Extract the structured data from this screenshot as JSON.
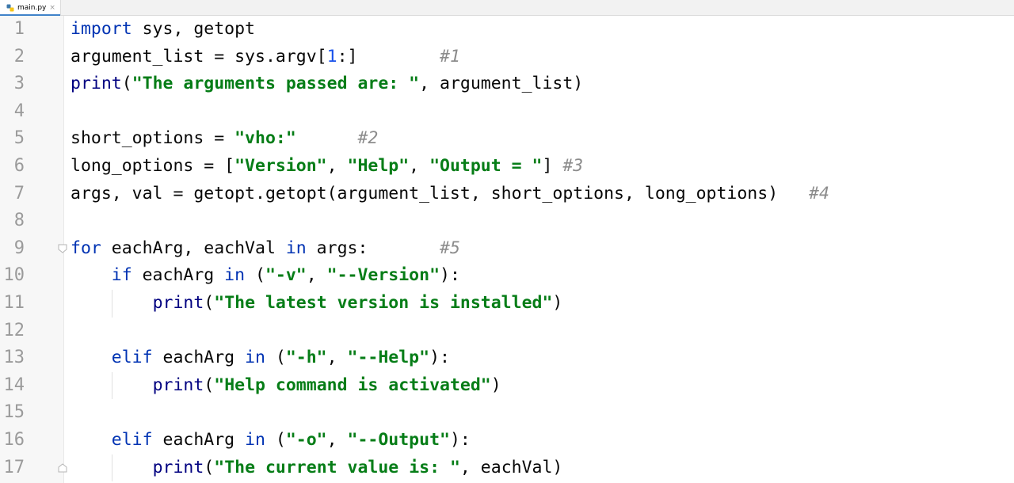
{
  "tab": {
    "filename": "main.py",
    "close": "×"
  },
  "line_numbers": [
    "1",
    "2",
    "3",
    "4",
    "5",
    "6",
    "7",
    "8",
    "9",
    "10",
    "11",
    "12",
    "13",
    "14",
    "15",
    "16",
    "17"
  ],
  "code_lines": [
    [
      {
        "t": "kw",
        "s": "import"
      },
      {
        "t": "",
        "s": " sys, getopt"
      }
    ],
    [
      {
        "t": "",
        "s": "argument_list = sys.argv["
      },
      {
        "t": "num",
        "s": "1"
      },
      {
        "t": "",
        "s": ":]"
      },
      {
        "t": "",
        "s": "        "
      },
      {
        "t": "cmt",
        "s": "#1"
      }
    ],
    [
      {
        "t": "bi",
        "s": "print"
      },
      {
        "t": "",
        "s": "("
      },
      {
        "t": "str",
        "s": "\"The arguments passed are: \""
      },
      {
        "t": "",
        "s": ", argument_list)"
      }
    ],
    [],
    [
      {
        "t": "",
        "s": "short_options = "
      },
      {
        "t": "str",
        "s": "\"vho:\""
      },
      {
        "t": "",
        "s": "      "
      },
      {
        "t": "cmt",
        "s": "#2"
      }
    ],
    [
      {
        "t": "",
        "s": "long_options = ["
      },
      {
        "t": "str",
        "s": "\"Version\""
      },
      {
        "t": "",
        "s": ", "
      },
      {
        "t": "str",
        "s": "\"Help\""
      },
      {
        "t": "",
        "s": ", "
      },
      {
        "t": "str",
        "s": "\"Output = \""
      },
      {
        "t": "",
        "s": "] "
      },
      {
        "t": "cmt",
        "s": "#3"
      }
    ],
    [
      {
        "t": "",
        "s": "args, val = getopt.getopt(argument_list, short_options, long_options)"
      },
      {
        "t": "",
        "s": "   "
      },
      {
        "t": "cmt",
        "s": "#4"
      }
    ],
    [],
    [
      {
        "t": "kw",
        "s": "for"
      },
      {
        "t": "",
        "s": " eachArg, eachVal "
      },
      {
        "t": "kw",
        "s": "in"
      },
      {
        "t": "",
        "s": " args:"
      },
      {
        "t": "",
        "s": "       "
      },
      {
        "t": "cmt",
        "s": "#5"
      }
    ],
    [
      {
        "t": "",
        "s": "    "
      },
      {
        "t": "kw",
        "s": "if"
      },
      {
        "t": "",
        "s": " eachArg "
      },
      {
        "t": "kw",
        "s": "in"
      },
      {
        "t": "",
        "s": " ("
      },
      {
        "t": "str",
        "s": "\"-v\""
      },
      {
        "t": "",
        "s": ", "
      },
      {
        "t": "str",
        "s": "\"--Version\""
      },
      {
        "t": "",
        "s": "):"
      }
    ],
    [
      {
        "t": "",
        "s": "        "
      },
      {
        "t": "bi",
        "s": "print"
      },
      {
        "t": "",
        "s": "("
      },
      {
        "t": "str",
        "s": "\"The latest version is installed\""
      },
      {
        "t": "",
        "s": ")"
      }
    ],
    [],
    [
      {
        "t": "",
        "s": "    "
      },
      {
        "t": "kw",
        "s": "elif"
      },
      {
        "t": "",
        "s": " eachArg "
      },
      {
        "t": "kw",
        "s": "in"
      },
      {
        "t": "",
        "s": " ("
      },
      {
        "t": "str",
        "s": "\"-h\""
      },
      {
        "t": "",
        "s": ", "
      },
      {
        "t": "str",
        "s": "\"--Help\""
      },
      {
        "t": "",
        "s": "):"
      }
    ],
    [
      {
        "t": "",
        "s": "        "
      },
      {
        "t": "bi",
        "s": "print"
      },
      {
        "t": "",
        "s": "("
      },
      {
        "t": "str",
        "s": "\"Help command is activated\""
      },
      {
        "t": "",
        "s": ")"
      }
    ],
    [],
    [
      {
        "t": "",
        "s": "    "
      },
      {
        "t": "kw",
        "s": "elif"
      },
      {
        "t": "",
        "s": " eachArg "
      },
      {
        "t": "kw",
        "s": "in"
      },
      {
        "t": "",
        "s": " ("
      },
      {
        "t": "str",
        "s": "\"-o\""
      },
      {
        "t": "",
        "s": ", "
      },
      {
        "t": "str",
        "s": "\"--Output\""
      },
      {
        "t": "",
        "s": "):"
      }
    ],
    [
      {
        "t": "",
        "s": "        "
      },
      {
        "t": "bi",
        "s": "print"
      },
      {
        "t": "",
        "s": "("
      },
      {
        "t": "str",
        "s": "\"The current value is: \""
      },
      {
        "t": "",
        "s": ", eachVal)"
      }
    ]
  ],
  "colors": {
    "keyword": "#0033b3",
    "builtin": "#000080",
    "string": "#067d17",
    "number": "#1750eb",
    "comment": "#8c8c8c",
    "line_number": "#9b9b9b",
    "gutter_bg": "#f7f7f7",
    "editor_bg": "#ffffff"
  },
  "icons": {
    "file": "python-file-icon"
  }
}
